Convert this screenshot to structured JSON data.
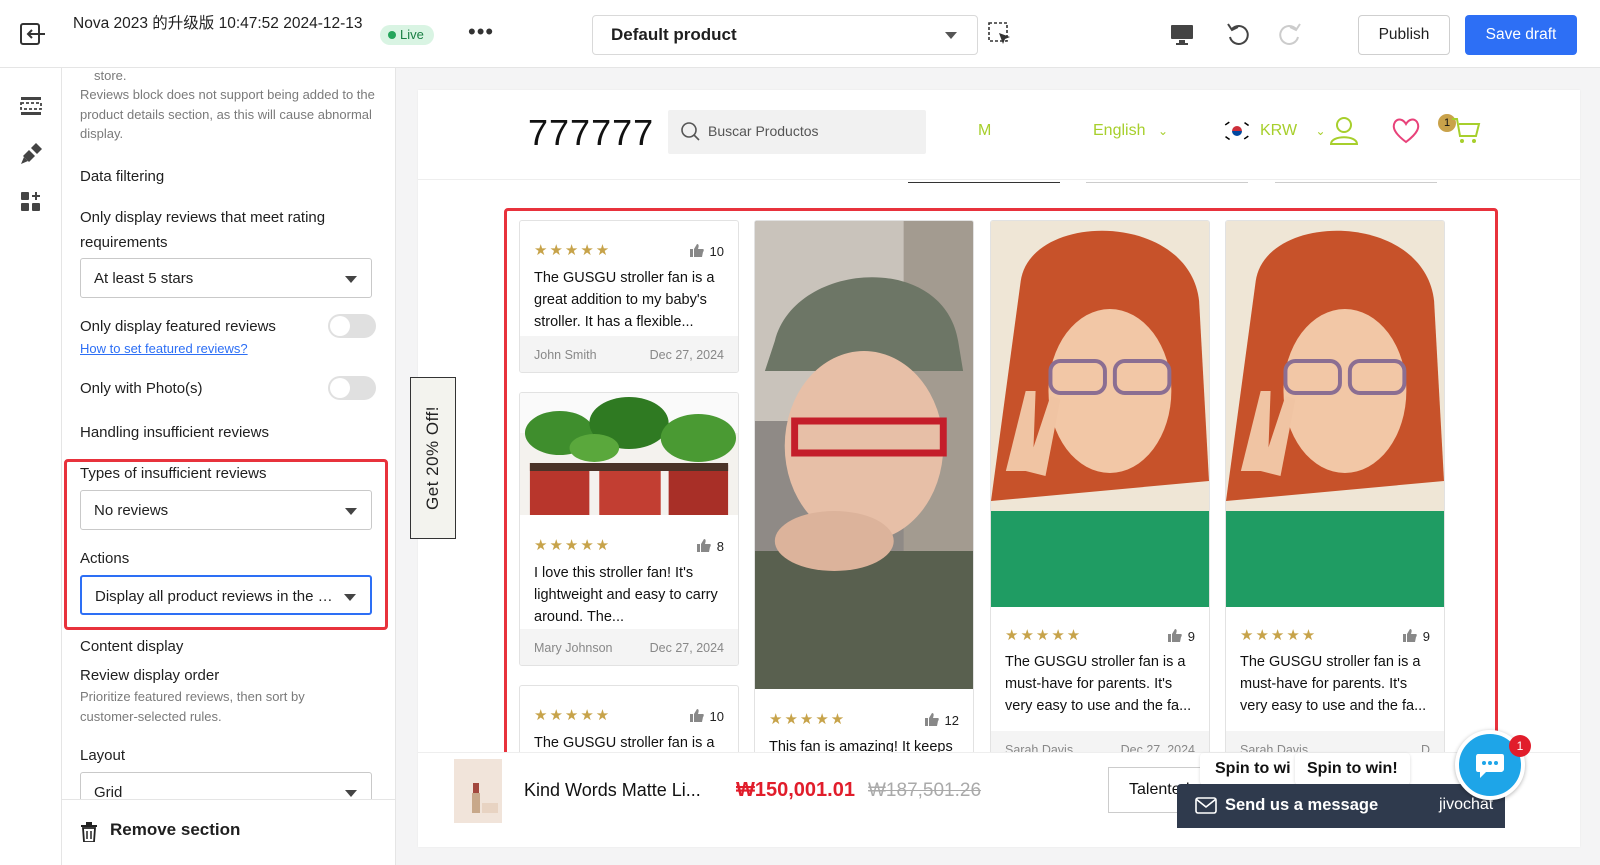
{
  "topbar": {
    "title": "Nova 2023 的升级版 10:47:52 2024-12-13",
    "live_label": "Live",
    "more": "•••",
    "product_select": "Default product",
    "publish_label": "Publish",
    "save_label": "Save draft"
  },
  "panel": {
    "store_fragment": "store.",
    "reviews_note": "Reviews block does not support being added to the product details section, as this will cause abnormal display.",
    "data_filtering_heading": "Data filtering",
    "rating_label": "Only display reviews that meet rating requirements",
    "rating_value": "At least 5 stars",
    "featured_label": "Only display featured reviews",
    "featured_link": "How to set featured reviews? ",
    "photo_label": "Only with Photo(s)",
    "insufficient_heading": "Handling insufficient reviews",
    "types_label": "Types of insufficient reviews",
    "types_value": "No reviews",
    "actions_label": "Actions",
    "actions_value": "Display all product reviews in the store",
    "content_display_heading": "Content display",
    "order_label": "Review display order",
    "order_note": "Prioritize featured reviews, then sort by customer-selected rules.",
    "layout_label": "Layout",
    "layout_value": "Grid",
    "remove_label": "Remove section"
  },
  "store": {
    "logo": "777777",
    "search_placeholder": "Buscar Productos",
    "menu_fragment": "M",
    "language": "English",
    "currency": "KRW",
    "wishlist_count": "1",
    "promo": "Get 20% Off!"
  },
  "reviews": [
    {
      "stars": "★★★★★",
      "likes": "10",
      "text": "The GUSGU stroller fan is a great addition to my baby's stroller. It has a flexible...",
      "author": "John Smith",
      "date": "Dec 27, 2024"
    },
    {
      "stars": "★★★★★",
      "likes": "8",
      "text": "I love this stroller fan! It's lightweight and easy to carry around. The...",
      "author": "Mary Johnson",
      "date": "Dec 27, 2024"
    },
    {
      "stars": "★★★★★",
      "likes": "10",
      "text": "The GUSGU stroller fan is a"
    },
    {
      "stars": "★★★★★",
      "likes": "12",
      "text": "This fan is amazing! It keeps"
    },
    {
      "stars": "★★★★★",
      "likes": "9",
      "text": "The GUSGU stroller fan is a must-have for parents. It's very easy to use and the fa...",
      "author": "Sarah Davis",
      "date": "Dec 27, 2024"
    },
    {
      "stars": "★★★★★",
      "likes": "9",
      "text": "The GUSGU stroller fan is a must-have for parents. It's very easy to use and the fa...",
      "author": "Sarah Davis",
      "date": "D"
    }
  ],
  "bottom": {
    "product_name": "Kind Words Matte Li...",
    "price": "₩150,001.01",
    "old_price": "₩187,501.26",
    "variant": "Talented",
    "spin1": "Spin to wi",
    "spin2": "Spin to win!",
    "message": "Send us a message",
    "brand": "jivochat",
    "chat_badge": "1"
  },
  "colors": {
    "accent": "#2d6ff5",
    "highlight": "#e8323c",
    "star": "#c7a34a",
    "store_green": "#a7cf2c",
    "price_red": "#e11d2b"
  }
}
